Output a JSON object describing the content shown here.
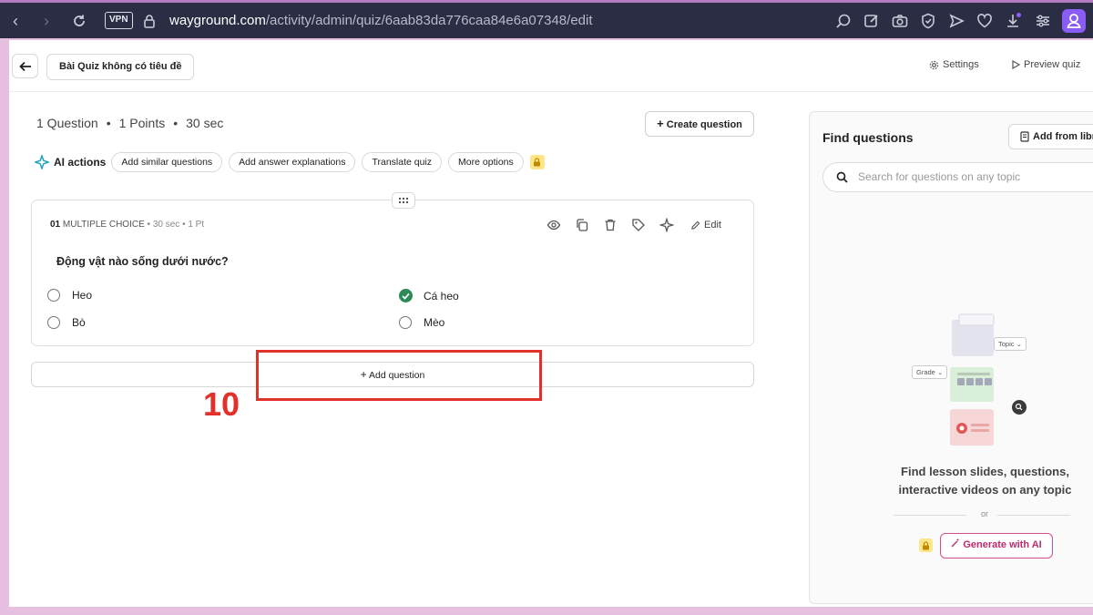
{
  "browser": {
    "vpn": "VPN",
    "url_host": "wayground.com",
    "url_path": "/activity/admin/quiz/6aab83da776caa84e6a07348/edit"
  },
  "header": {
    "quiz_title": "Bài Quiz không có tiêu đề",
    "settings": "Settings",
    "preview": "Preview quiz"
  },
  "summary": {
    "questions": "1 Question",
    "points": "1 Points",
    "time": "30 sec",
    "separator": "•"
  },
  "create_question": "Create question",
  "ai": {
    "label": "AI actions",
    "chips": [
      "Add similar questions",
      "Add answer explanations",
      "Translate quiz",
      "More options"
    ]
  },
  "question": {
    "number": "01",
    "type": "MULTIPLE CHOICE",
    "time": "30 sec",
    "points": "1 Pt",
    "edit": "Edit",
    "text": "Động vật nào sống dưới nước?",
    "answers": [
      {
        "text": "Heo",
        "correct": false
      },
      {
        "text": "Cá heo",
        "correct": true
      },
      {
        "text": "Bò",
        "correct": false
      },
      {
        "text": "Mèo",
        "correct": false
      }
    ]
  },
  "add_question": "Add question",
  "annotation": {
    "step": "10",
    "color": "#e2312b"
  },
  "find_panel": {
    "title": "Find questions",
    "add_library": "Add from libra",
    "search_placeholder": "Search for questions on any topic",
    "illus_topic": "Topic",
    "illus_grade": "Grade",
    "empty_line1": "Find lesson slides, questions,",
    "empty_line2": "interactive videos on any topic",
    "or": "or",
    "generate": "Generate with AI"
  },
  "colors": {
    "accent_correct": "#2e8a57",
    "generate_ai": "#c0296f",
    "browser_bg": "#2a2d43"
  }
}
